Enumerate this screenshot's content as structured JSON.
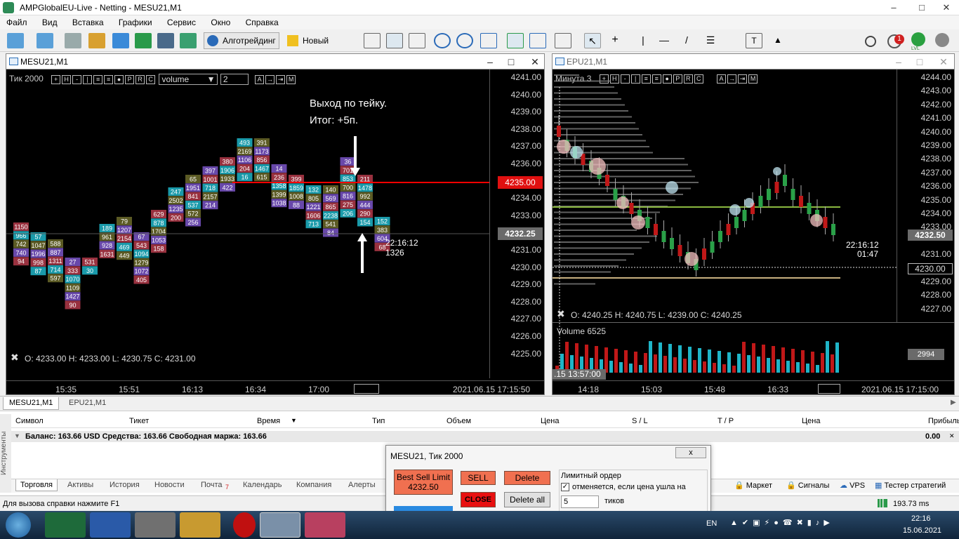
{
  "window": {
    "title": "AMPGlobalEU-Live - Netting - MESU21,M1"
  },
  "menu": [
    "Файл",
    "Вид",
    "Вставка",
    "Графики",
    "Сервис",
    "Окно",
    "Справка"
  ],
  "toolbar": {
    "algo_label": "Алготрейдинг",
    "new_order_label": "Новый ордер",
    "notif_count": "1",
    "lvl": "LVL"
  },
  "chart1": {
    "title": "MESU21,M1",
    "mode_label": "Тик  2000",
    "volume_select": "volume",
    "value_input": "2",
    "price_ticks": [
      "4241.00",
      "4240.00",
      "4239.00",
      "4238.00",
      "4237.00",
      "4236.00",
      "4235.00",
      "4234.00",
      "4233.00",
      "4232.25",
      "4231.00",
      "4230.00",
      "4229.00",
      "4228.00",
      "4227.00",
      "4226.00",
      "4225.00"
    ],
    "current_price": "4235.00",
    "last_price": "4232.25",
    "time_ticks": [
      "15:35",
      "15:51",
      "16:13",
      "16:34",
      "17:00"
    ],
    "datetime": "2021.06.15 17:15:50",
    "ohlc": "O: 4233.00   H: 4233.00   L: 4230.75   C: 4231.00",
    "annotation_line1": "Выход по тейку.",
    "annotation_line2": "Итог: +5п.",
    "timer": "22:16:12",
    "count": "1326",
    "cells": [
      [
        "1150",
        "966",
        "742",
        "740",
        "94"
      ],
      [
        "57",
        "1047",
        "1996",
        "998",
        "87"
      ],
      [
        "588",
        "887",
        "1311",
        "714",
        "597"
      ],
      [
        "27",
        "333",
        "1070",
        "1109",
        "1427",
        "90"
      ],
      [
        "531",
        "30"
      ],
      [
        "189",
        "961",
        "928",
        "1631"
      ],
      [
        "79",
        "1207",
        "2154",
        "469",
        "449"
      ],
      [
        "67",
        "543",
        "1094",
        "1279",
        "1072",
        "405"
      ],
      [
        "629",
        "878",
        "1704",
        "1053",
        "158"
      ],
      [
        "247",
        "2502",
        "1235",
        "200"
      ],
      [
        "65",
        "1951",
        "841",
        "537",
        "572",
        "256"
      ],
      [
        "397",
        "1001",
        "718",
        "2157",
        "214"
      ],
      [
        "380",
        "1906",
        "1933",
        "422"
      ],
      [
        "493",
        "2169",
        "1106",
        "204",
        "16"
      ],
      [
        "391",
        "1173",
        "856",
        "1467",
        "615"
      ],
      [
        "14",
        "236",
        "1358",
        "1399",
        "1038"
      ],
      [
        "399",
        "1859",
        "1008",
        "88"
      ],
      [
        "132",
        "805",
        "1221",
        "1606",
        "713"
      ],
      [
        "140",
        "569",
        "865",
        "2238",
        "541",
        "84"
      ],
      [
        "36",
        "701",
        "853",
        "700",
        "816",
        "275",
        "206"
      ],
      [
        "211",
        "1478",
        "992",
        "444",
        "290",
        "154"
      ],
      [
        "152",
        "383",
        "604",
        "68"
      ]
    ]
  },
  "chart2": {
    "title": "EPU21,M1",
    "mode_label": "Минута  3",
    "price_ticks": [
      "4244.00",
      "4243.00",
      "4242.00",
      "4241.00",
      "4240.00",
      "4239.00",
      "4238.00",
      "4237.00",
      "4236.00",
      "4235.00",
      "4234.00",
      "4233.00",
      "4232.50",
      "4231.00",
      "4230.00",
      "4229.00",
      "4228.00",
      "4227.00"
    ],
    "last_price": "4232.50",
    "marked_price": "4230.00",
    "ohlc": "O: 4240.25   H: 4240.75   L: 4239.00   C: 4240.25",
    "volume_label": "Volume 6525",
    "volume_value": "2994",
    "timer": "22:16:12",
    "timer2": "01:47",
    "time_ticks": [
      "14:18",
      "15:03",
      "15:48",
      "16:33"
    ],
    "time_label": ".15 13:57:00",
    "datetime": "2021.06.15 17:15:00"
  },
  "chart_tabs": [
    "MESU21,M1",
    "EPU21,M1"
  ],
  "terminal": {
    "columns": [
      "Символ",
      "Тикет",
      "Время",
      "Тип",
      "Объем",
      "Цена",
      "S / L",
      "T / P",
      "Цена",
      "Прибыль"
    ],
    "balance": "Баланс: 163.66 USD  Средства: 163.66  Свободная маржа: 163.66",
    "profit": "0.00",
    "side_label": "Инструменты",
    "tabs": [
      "Торговля",
      "Активы",
      "История",
      "Новости",
      "Почта",
      "Календарь",
      "Компания",
      "Алерты"
    ],
    "mail_count": "7",
    "right_items": [
      "Маркет",
      "Сигналы",
      "VPS",
      "Тестер стратегий"
    ]
  },
  "status": {
    "help": "Для вызова справки нажмите F1",
    "ping": "193.73 ms"
  },
  "order_panel": {
    "title": "MESU21, Тик  2000",
    "best_sell": "Best Sell Limit",
    "best_sell_price": "4232.50",
    "sell": "SELL",
    "close": "CLOSE",
    "delete": "Delete",
    "delete_all": "Delete all",
    "limit_label": "Лимитный ордер",
    "cancel_label": "отменяется, если цена ушла на",
    "ticks_value": "5",
    "ticks_label": "тиков",
    "close_x": "x"
  },
  "taskbar": {
    "lang": "EN",
    "time": "22:16",
    "date": "15.06.2021"
  },
  "colors": {
    "red_line": "#ff0000",
    "cell_cyan": "#1fb5c8",
    "cell_purple": "#7a55c8",
    "cell_red": "#b43a4a",
    "cell_olive": "#6b6a2a"
  }
}
